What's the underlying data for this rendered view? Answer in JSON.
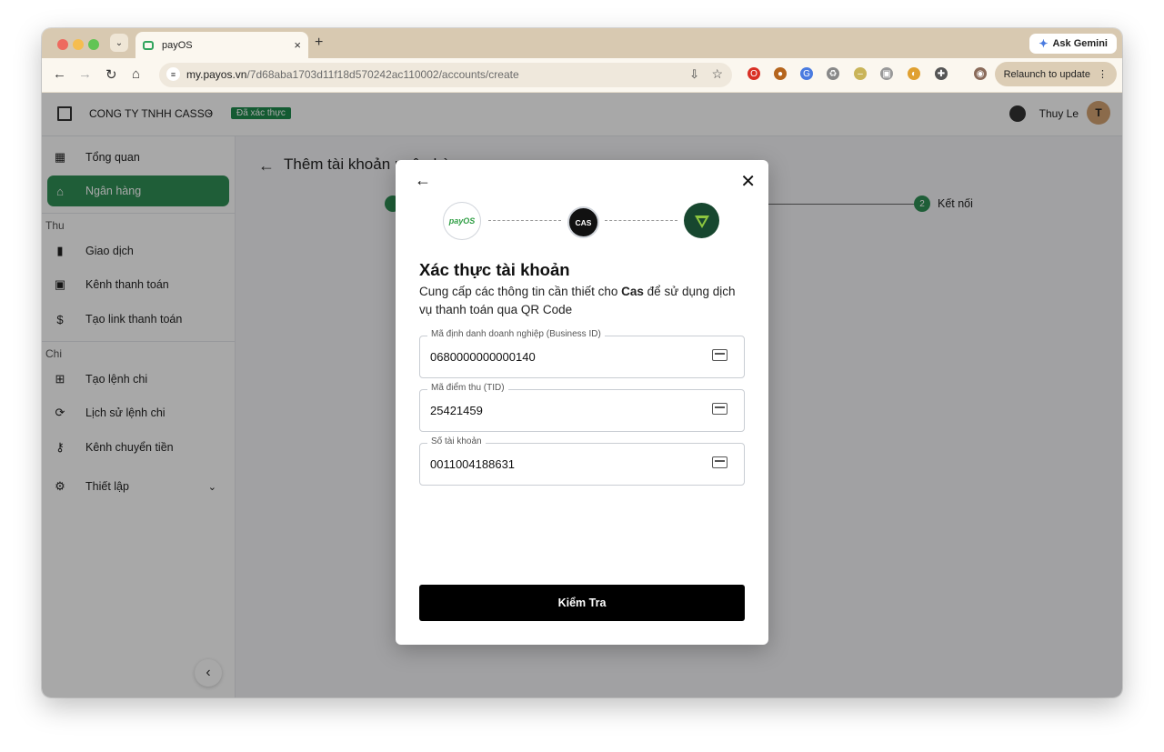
{
  "browser": {
    "tab_title": "payOS",
    "new_tab": "+",
    "tab_close": "×",
    "ask_gemini": "Ask Gemini",
    "url_host": "my.payos.vn",
    "url_path": "/7d68aba1703d11f18d570242ac110002/accounts/create",
    "relaunch": "Relaunch to update"
  },
  "header": {
    "company": "CONG TY TNHH CASSO",
    "verified": "Đã xác thực",
    "user_name": "Thuy Le",
    "avatar_letter": "T"
  },
  "sidebar": {
    "overview": "Tổng quan",
    "bank": "Ngân hàng",
    "section_in": "Thu",
    "transactions": "Giao dịch",
    "payment_channel": "Kênh thanh toán",
    "create_link": "Tạo link thanh toán",
    "section_out": "Chi",
    "create_payout": "Tạo lệnh chi",
    "payout_history": "Lịch sử lệnh chi",
    "transfer_channel": "Kênh chuyển tiền",
    "settings": "Thiết lập"
  },
  "main": {
    "title": "Thêm tài khoản",
    "title_rest": "ngân hàng",
    "step2_number": "2",
    "step2_label": "Kết nối"
  },
  "modal": {
    "payos_logo": "payOS",
    "cas_logo": "CAS",
    "title": "Xác thực tài khoản",
    "desc_before": "Cung cấp các thông tin cần thiết cho ",
    "desc_bold": "Cas",
    "desc_after": " để sử dụng dịch vụ thanh toán qua QR Code",
    "fields": [
      {
        "label": "Mã định danh doanh nghiệp (Business ID)",
        "value": "0680000000000140",
        "icon": "folder-icon"
      },
      {
        "label": "Mã điểm thu (TID)",
        "value": "25421459",
        "icon": "card-check-icon"
      },
      {
        "label": "Số tài khoản",
        "value": "0011004188631",
        "icon": "credit-card-icon"
      }
    ],
    "submit": "Kiểm Tra"
  },
  "colors": {
    "accent": "#2f8f55",
    "button": "#000000",
    "overlay": "rgba(0,0,0,0.34)"
  }
}
